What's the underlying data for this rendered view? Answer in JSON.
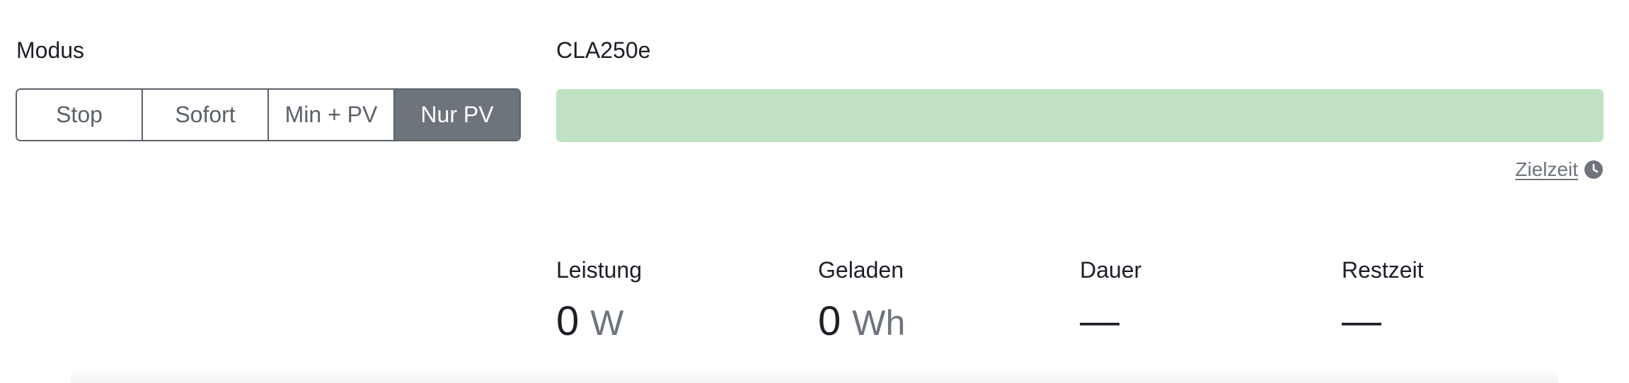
{
  "mode": {
    "label": "Modus",
    "options": [
      {
        "label": "Stop",
        "active": false
      },
      {
        "label": "Sofort",
        "active": false
      },
      {
        "label": "Min + PV",
        "active": false
      },
      {
        "label": "Nur PV",
        "active": true
      }
    ]
  },
  "vehicle": {
    "title": "CLA250e",
    "progress": {
      "percent": 100,
      "color": "#c0e2c3"
    },
    "target_time": {
      "label": "Zielzeit",
      "icon": "clock-icon"
    }
  },
  "stats": [
    {
      "label": "Leistung",
      "value": "0",
      "unit": "W"
    },
    {
      "label": "Geladen",
      "value": "0",
      "unit": "Wh"
    },
    {
      "label": "Dauer",
      "value": "—",
      "unit": ""
    },
    {
      "label": "Restzeit",
      "value": "—",
      "unit": ""
    }
  ],
  "colors": {
    "active_mode": "#6e747c",
    "muted_text": "#6e747c",
    "progress_fill": "#c0e2c3"
  }
}
